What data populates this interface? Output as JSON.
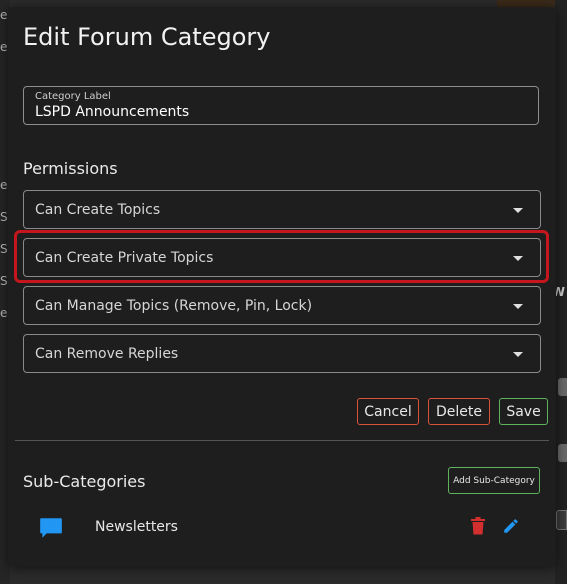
{
  "modal": {
    "title": "Edit Forum Category",
    "category_field": {
      "label": "Category Label",
      "value": "LSPD Announcements"
    },
    "permissions_title": "Permissions",
    "permissions": [
      {
        "label": "Can Create Topics"
      },
      {
        "label": "Can Create Private Topics",
        "highlighted": true
      },
      {
        "label": "Can Manage Topics (Remove, Pin, Lock)"
      },
      {
        "label": "Can Remove Replies"
      }
    ],
    "buttons": {
      "cancel": "Cancel",
      "delete": "Delete",
      "save": "Save"
    },
    "subcategories_title": "Sub-Categories",
    "add_subcategory_label": "Add Sub-Category",
    "subcategories": [
      {
        "name": "Newsletters",
        "icon": "chat-bubble-icon"
      }
    ]
  },
  "background": {
    "left_fragments": [
      "ec",
      "ec",
      "ec",
      "Se",
      "Se",
      "Se",
      "ec"
    ],
    "right_fragments": [
      "W"
    ]
  },
  "colors": {
    "modal_bg": "#1e1e1e",
    "highlight": "#c4161c",
    "danger": "#d9533a",
    "success": "#5fb35f",
    "icon_blue": "#2196f3",
    "trash_red": "#d32f2f"
  }
}
